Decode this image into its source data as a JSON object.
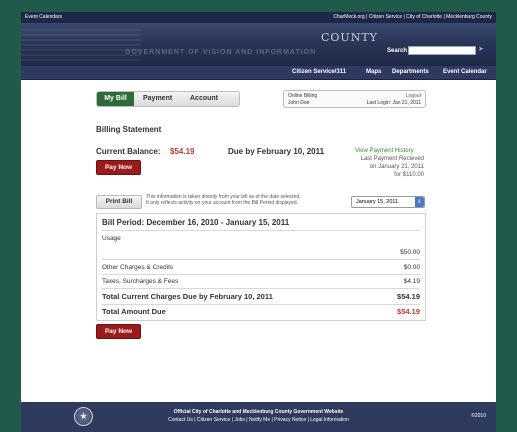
{
  "topbar": {
    "left": "Event Calendars",
    "right": "CharMeck.org | Citizen Service | City of Charlotte | Mecklenburg County"
  },
  "banner": {
    "faint_text": "GOVERNMENT  OF  VISION  AND  INFORMATION",
    "county": "COUNTY",
    "search_label": "Search",
    "search_value": ""
  },
  "nav": {
    "items": [
      "Citizen Service/311",
      "Maps",
      "Departments",
      "Event Calendar"
    ]
  },
  "tabs": {
    "items": [
      "My Bill",
      "Payment",
      "Account"
    ]
  },
  "account_box": {
    "title": "Online Billing",
    "name": "John Doe",
    "logout": "Logout",
    "last_login": "Last Login: Jan 21, 2011"
  },
  "billing": {
    "heading": "Billing Statement",
    "current_balance_label": "Current Balance:",
    "current_balance": "$54.19",
    "due_text": "Due by February 10, 2011",
    "pay_now": "Pay Now",
    "view_history": "View Payment History",
    "last_payment_line1": "Last Payment Recieved",
    "last_payment_line2": "on January 21, 2011",
    "last_payment_line3": "for $110.00"
  },
  "print": {
    "button": "Print Bill",
    "note_line1": "This information is taken directly from your bill as of the date selected.",
    "note_line2": "It only reflects activity on your account from the Bill Period displayed.",
    "date_selected": "January 15, 2011"
  },
  "bill": {
    "period": "Bill Period: December 16, 2010 - January 15, 2011",
    "usage_label": "Usage",
    "usage_amount": "$50.00",
    "other_label": "Other Charges & Credits",
    "other_amount": "$0.00",
    "taxes_label": "Taxes, Surcharges & Fees",
    "taxes_amount": "$4.19",
    "total_current_label": "Total Current Charges Due by February 10, 2011",
    "total_current_amount": "$54.19",
    "total_due_label": "Total Amount Due",
    "total_due_amount": "$54.19"
  },
  "footer": {
    "line1": "Official City of Charlotte and Mecklenburg County Government Website",
    "line2": "Contact Us | Citizen Service | Jobs | Notify Me | Privacy Notice | Legal Information",
    "copyright": "©2010"
  },
  "colors": {
    "accent_green": "#2e6b3a",
    "pay_red": "#9b1b1b",
    "amount_red": "#c0392b",
    "navy": "#2e3a62"
  }
}
